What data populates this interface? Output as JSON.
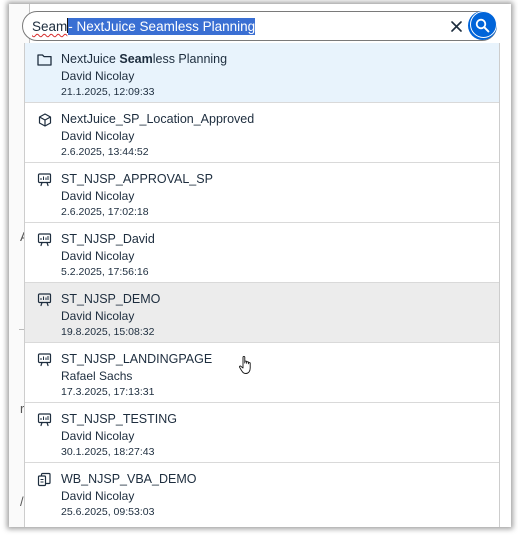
{
  "search": {
    "typed_text": "Seam",
    "selected_completion": "- NextJuice Seamless Planning"
  },
  "icons": {
    "clear": "close-icon",
    "search": "search-icon",
    "folder": "folder-icon",
    "model": "cube-icon",
    "story": "presentation-screen-icon",
    "workbook": "workbook-icon"
  },
  "results": [
    {
      "title_pre": "NextJuice ",
      "title_match": "Seam",
      "title_post": "less Planning",
      "owner": "David Nicolay",
      "date": "21.1.2025, 12:09:33",
      "icon": "folder"
    },
    {
      "title_pre": "NextJuice_SP_Location_Approved",
      "title_match": "",
      "title_post": "",
      "owner": "David Nicolay",
      "date": "2.6.2025, 13:44:52",
      "icon": "model"
    },
    {
      "title_pre": "ST_NJSP_APPROVAL_SP",
      "title_match": "",
      "title_post": "",
      "owner": "David Nicolay",
      "date": "2.6.2025, 17:02:18",
      "icon": "story"
    },
    {
      "title_pre": "ST_NJSP_David",
      "title_match": "",
      "title_post": "",
      "owner": "David Nicolay",
      "date": "5.2.2025, 17:56:16",
      "icon": "story"
    },
    {
      "title_pre": "ST_NJSP_DEMO",
      "title_match": "",
      "title_post": "",
      "owner": "David Nicolay",
      "date": "19.8.2025, 15:08:32",
      "icon": "story"
    },
    {
      "title_pre": "ST_NJSP_LANDINGPAGE",
      "title_match": "",
      "title_post": "",
      "owner": "Rafael Sachs",
      "date": "17.3.2025, 17:13:31",
      "icon": "story"
    },
    {
      "title_pre": "ST_NJSP_TESTING",
      "title_match": "",
      "title_post": "",
      "owner": "David Nicolay",
      "date": "30.1.2025, 18:27:43",
      "icon": "story"
    },
    {
      "title_pre": "WB_NJSP_VBA_DEMO",
      "title_match": "",
      "title_post": "",
      "owner": "David Nicolay",
      "date": "25.6.2025, 09:53:03",
      "icon": "workbook"
    }
  ],
  "colors": {
    "accent": "#0064d9",
    "selection": "#3a6fd3",
    "active_row": "#e8f3fc",
    "hover_row": "#ececec",
    "text": "#1d2d3e"
  }
}
